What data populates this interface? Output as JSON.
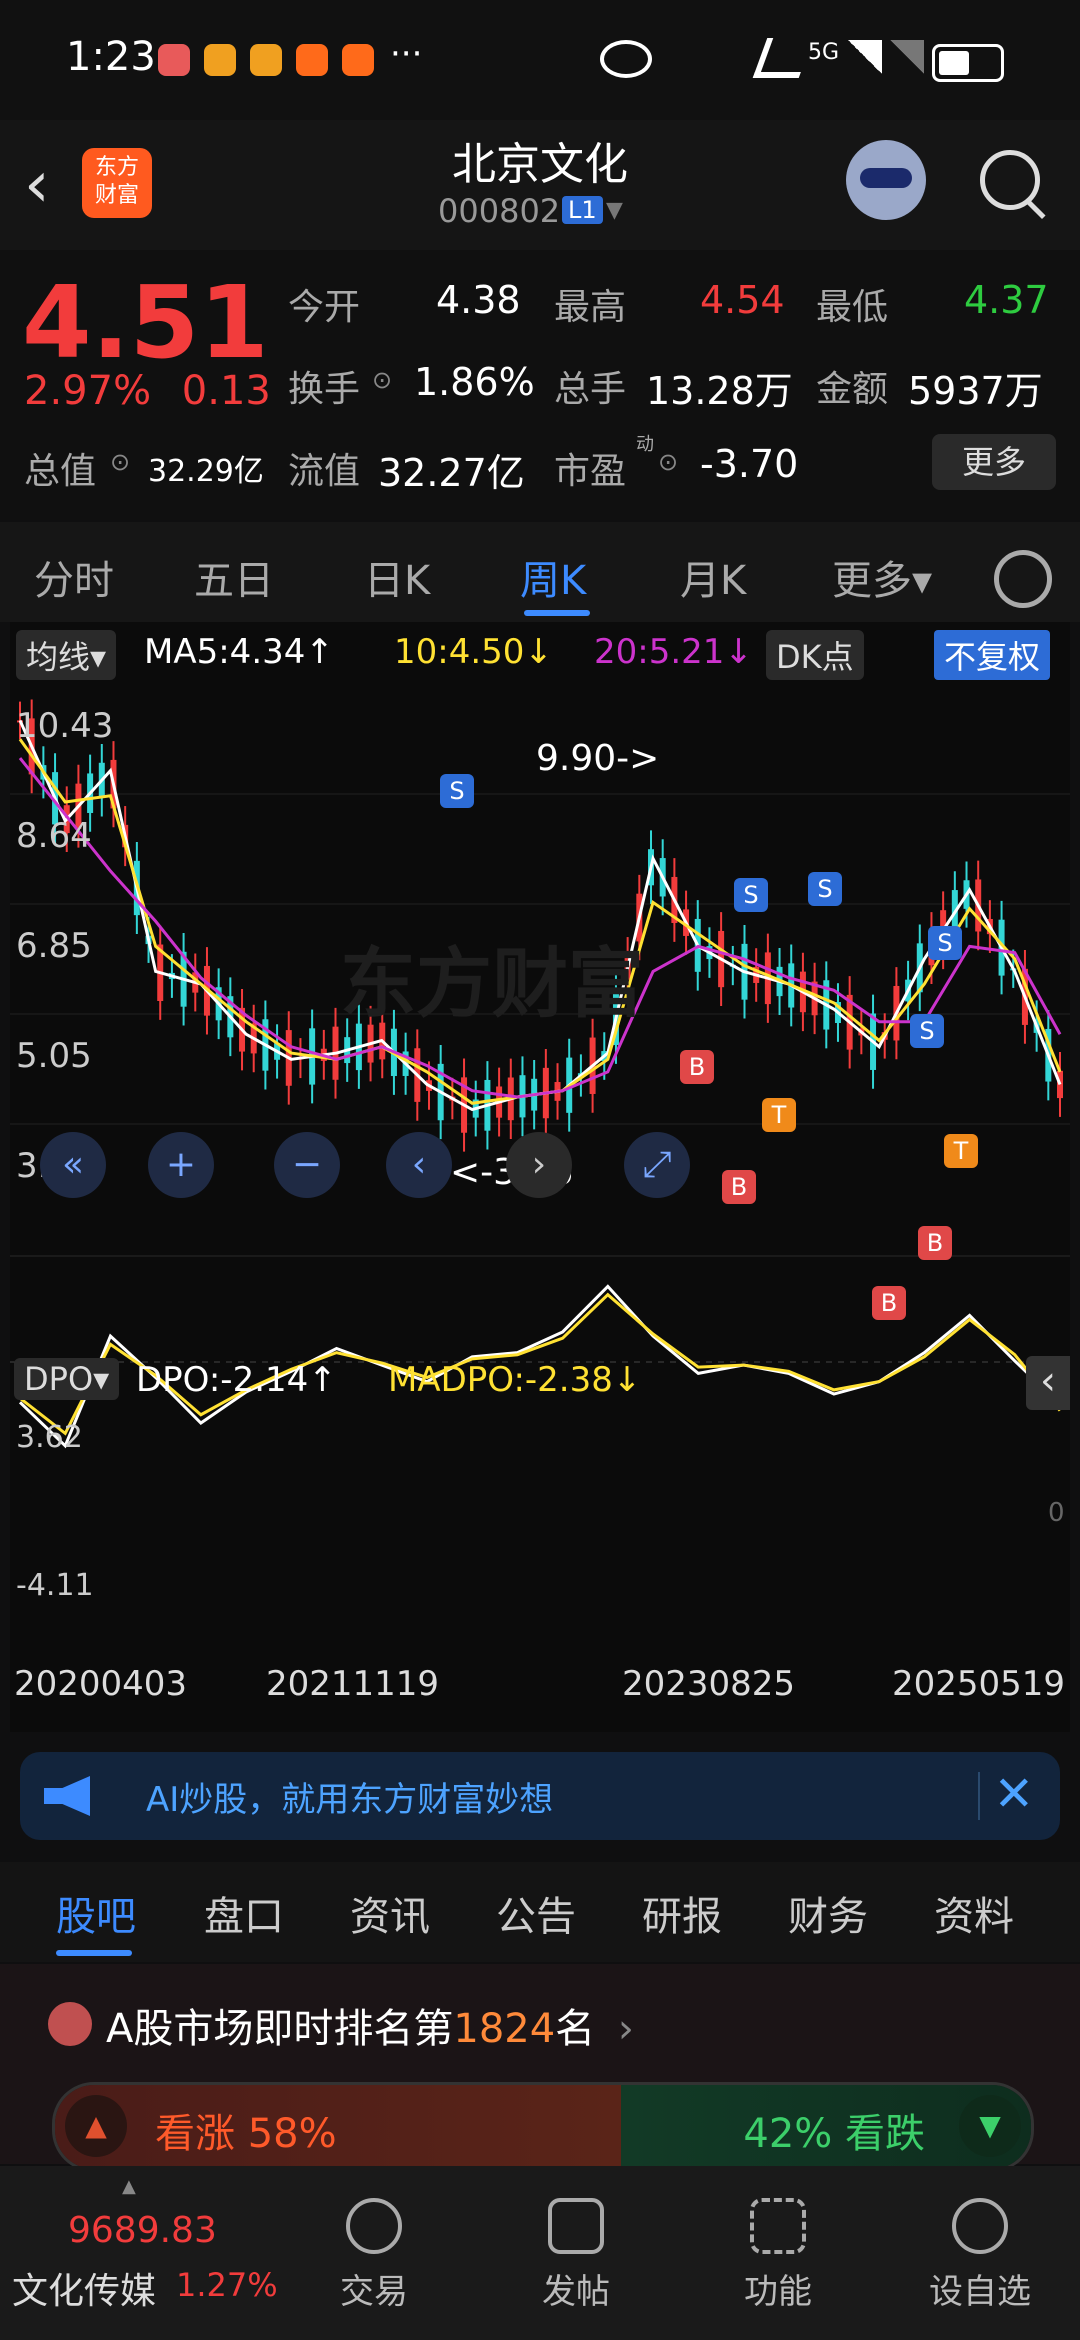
{
  "status_bar": {
    "time": "1:23",
    "dots": "···",
    "network": "5G"
  },
  "header": {
    "back_icon": "chevron-left-icon",
    "logo_text": "东方\n财富",
    "name": "北京文化",
    "code": "000802",
    "level": "L1"
  },
  "quote": {
    "price": "4.51",
    "change_pct": "2.97%",
    "change": "0.13",
    "fields": [
      {
        "label": "今开",
        "value": "4.38",
        "color": "#ffffff"
      },
      {
        "label": "最高",
        "value": "4.54",
        "color": "#f23c3c"
      },
      {
        "label": "最低",
        "value": "4.37",
        "color": "#2ecc40"
      },
      {
        "label": "换手",
        "value": "1.86%",
        "color": "#ffffff"
      },
      {
        "label": "总手",
        "value": "13.28万",
        "color": "#ffffff"
      },
      {
        "label": "金额",
        "value": "5937万",
        "color": "#ffffff"
      },
      {
        "label": "总值",
        "value": "32.29亿",
        "color": "#ffffff"
      },
      {
        "label": "流值",
        "value": "32.27亿",
        "color": "#ffffff"
      },
      {
        "label": "市盈",
        "value": "-3.70",
        "color": "#ffffff"
      }
    ],
    "pe_superscript": "动",
    "more": "更多"
  },
  "period_tabs": {
    "items": [
      "分时",
      "五日",
      "日K",
      "周K",
      "月K",
      "更多▾"
    ],
    "active": "周K"
  },
  "chart": {
    "ma_selector": "均线▾",
    "ma5": "MA5:4.34↑",
    "ma10": "10:4.50↓",
    "ma20": "20:5.21↓",
    "dk": "DK点",
    "adj": "不复权",
    "watermark": "东方财富",
    "y_ticks": [
      "10.43",
      "8.64",
      "6.85",
      "5.05",
      "3.26"
    ],
    "high_note": "9.90->",
    "low_note": "<-3.26",
    "dpo_selector": "DPO▾",
    "dpo": "DPO:-2.14↑",
    "madpo": "MADPO:-2.38↓",
    "dpo_ticks": [
      "3.62",
      "0",
      "-4.11"
    ],
    "dates": [
      "20200403",
      "20211119",
      "20230825",
      "20250519"
    ]
  },
  "chart_data": {
    "type": "line",
    "title": "",
    "ylim": [
      3.26,
      10.43
    ],
    "series": [
      {
        "name": "MA5",
        "values": [
          10.2,
          8.6,
          9.4,
          6.2,
          6.0,
          5.2,
          4.8,
          4.9,
          5.1,
          4.4,
          4.0,
          4.2,
          4.3,
          4.9,
          8.0,
          6.6,
          6.2,
          6.0,
          5.6,
          5.0,
          6.4,
          7.5,
          6.2,
          4.4
        ],
        "color": "#ffffff"
      },
      {
        "name": "10",
        "values": [
          9.9,
          8.9,
          9.0,
          6.6,
          6.0,
          5.4,
          4.9,
          4.8,
          5.0,
          4.6,
          4.1,
          4.2,
          4.3,
          4.8,
          7.3,
          6.8,
          6.3,
          6.0,
          5.7,
          5.1,
          6.0,
          7.2,
          6.4,
          4.6
        ],
        "color": "#ffe133"
      },
      {
        "name": "20",
        "values": [
          9.6,
          8.7,
          7.8,
          7.0,
          6.1,
          5.5,
          5.0,
          4.8,
          5.0,
          4.7,
          4.3,
          4.2,
          4.3,
          4.6,
          6.2,
          6.6,
          6.4,
          6.1,
          5.9,
          5.4,
          5.4,
          6.6,
          6.5,
          5.2
        ],
        "color": "#cc33cc"
      }
    ],
    "dpo_series": [
      {
        "name": "DPO",
        "values": [
          -2.0,
          -4.1,
          1.2,
          -0.8,
          -3.0,
          -1.5,
          -0.5,
          0.6,
          -0.2,
          -1.0,
          0.2,
          0.4,
          1.4,
          3.6,
          1.2,
          -0.6,
          -0.2,
          -0.6,
          -1.6,
          -1.0,
          0.4,
          2.2,
          0.0,
          -2.1
        ],
        "color": "#ffffff"
      },
      {
        "name": "MADPO",
        "values": [
          -1.8,
          -3.5,
          0.8,
          -0.7,
          -2.6,
          -1.4,
          -0.4,
          0.4,
          -0.1,
          -0.8,
          0.1,
          0.3,
          1.1,
          3.2,
          1.3,
          -0.3,
          -0.2,
          -0.5,
          -1.4,
          -1.0,
          0.2,
          2.0,
          0.3,
          -2.4
        ],
        "color": "#ffe133"
      }
    ],
    "signals": [
      "S",
      "S",
      "S",
      "S",
      "S",
      "B",
      "B",
      "B",
      "B",
      "T",
      "T"
    ]
  },
  "banner": {
    "text": "AI炒股，就用东方财富妙想",
    "close": "✕"
  },
  "sub_tabs": {
    "items": [
      "股吧",
      "盘口",
      "资讯",
      "公告",
      "研报",
      "财务",
      "资料"
    ],
    "active": "股吧"
  },
  "ranking": {
    "prefix": "A股市场即时排名第",
    "rank": "1824",
    "suffix": "名",
    "up_label": "看涨 58%",
    "down_label": "42% 看跌",
    "up_pct": 58
  },
  "bottom_nav": {
    "index_value": "9689.83",
    "index_name": "文化传媒",
    "index_change": "1.27%",
    "items": [
      {
        "label": "交易"
      },
      {
        "label": "发帖"
      },
      {
        "label": "功能"
      },
      {
        "label": "设自选"
      }
    ]
  }
}
